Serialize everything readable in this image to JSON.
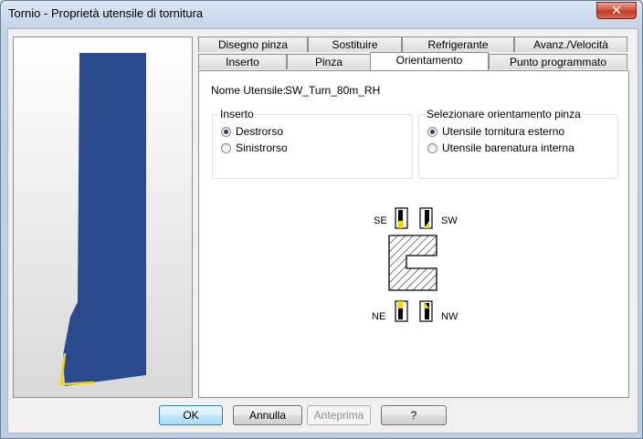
{
  "window": {
    "title": "Tornio - Proprietà utensile di tornitura",
    "close_symbol": "✕"
  },
  "tabs": {
    "row1": [
      "Disegno pinza",
      "Sostituire",
      "Refrigerante",
      "Avanz./Velocità"
    ],
    "row2": [
      "Inserto",
      "Pinza",
      "Orientamento",
      "Punto programmato"
    ],
    "active": "Orientamento"
  },
  "tool": {
    "name_label": "Nome Utensile:",
    "name_value": "SW_Turn_80m_RH"
  },
  "insert_group": {
    "title": "Inserto",
    "options": [
      "Destrorso",
      "Sinistrorso"
    ],
    "selected": "Destrorso"
  },
  "holder_group": {
    "title": "Selezionare orientamento pinza",
    "options": [
      "Utensile tornitura esterno",
      "Utensile barenatura interna"
    ],
    "selected": "Utensile tornitura esterno"
  },
  "orientation_labels": {
    "se": "SE",
    "sw": "SW",
    "ne": "NE",
    "nw": "NW"
  },
  "colors": {
    "tool_body": "#2b4a8d",
    "insert": "#f4d400",
    "panel_bg": "#ffffff"
  },
  "buttons": {
    "ok": "OK",
    "cancel": "Annulla",
    "preview": "Anteprima",
    "help": "?"
  }
}
